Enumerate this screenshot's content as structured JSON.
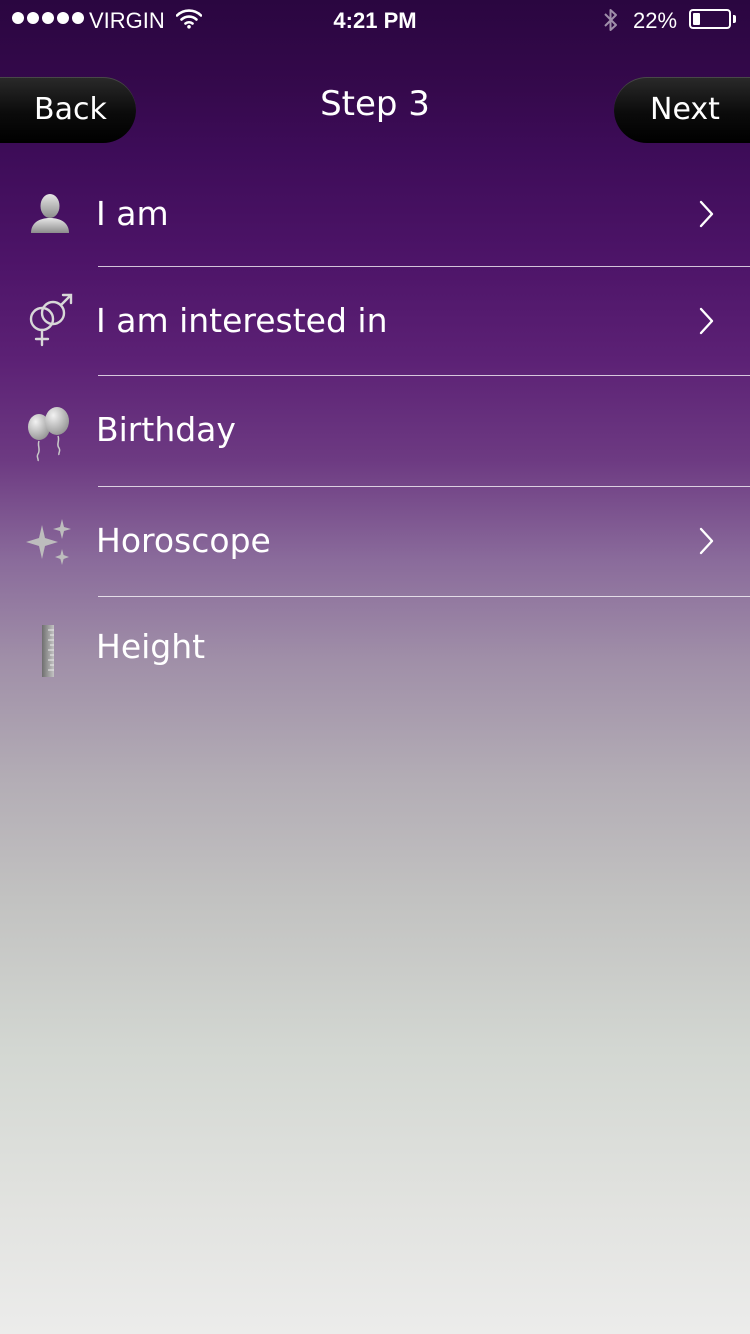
{
  "status_bar": {
    "carrier": "VIRGIN",
    "time": "4:21 PM",
    "battery_percent": "22%",
    "battery_level": 0.22,
    "signal_bars": 5
  },
  "nav": {
    "back_label": "Back",
    "title": "Step 3",
    "next_label": "Next"
  },
  "rows": [
    {
      "label": "I am",
      "icon": "person-icon",
      "has_chevron": true
    },
    {
      "label": "I am interested in",
      "icon": "gender-symbols-icon",
      "has_chevron": true
    },
    {
      "label": "Birthday",
      "icon": "balloons-icon",
      "has_chevron": false
    },
    {
      "label": "Horoscope",
      "icon": "sparkles-icon",
      "has_chevron": true
    },
    {
      "label": "Height",
      "icon": "ruler-icon",
      "has_chevron": false
    }
  ],
  "colors": {
    "background_top": "#2a0640",
    "background_bottom": "#ececeb",
    "nav_button": "#000000",
    "text": "#ffffff"
  }
}
